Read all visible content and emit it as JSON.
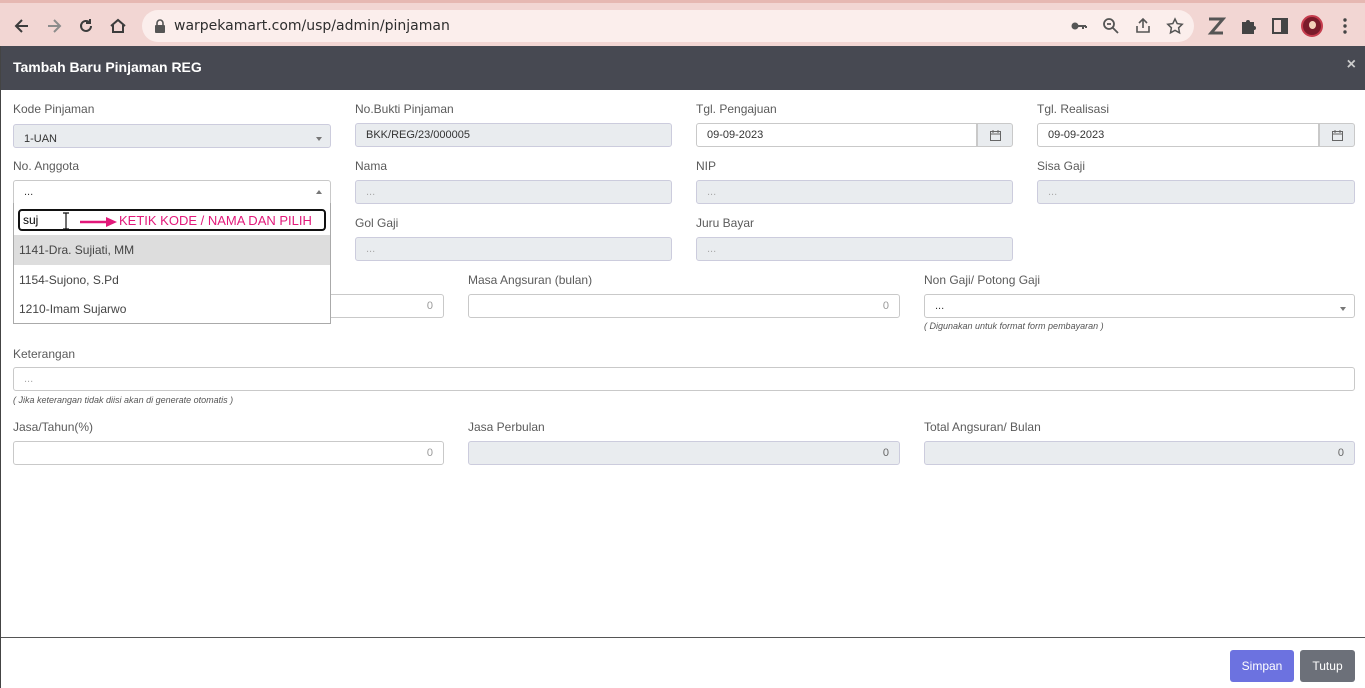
{
  "browser": {
    "url": "warpekamart.com/usp/admin/pinjaman"
  },
  "modal": {
    "title": "Tambah Baru Pinjaman REG",
    "close": "×"
  },
  "form": {
    "kode_pinjaman": {
      "label": "Kode Pinjaman",
      "value": "1-UAN"
    },
    "no_bukti": {
      "label": "No.Bukti Pinjaman",
      "value": "BKK/REG/23/000005"
    },
    "tgl_pengajuan": {
      "label": "Tgl. Pengajuan",
      "value": "09-09-2023"
    },
    "tgl_realisasi": {
      "label": "Tgl. Realisasi",
      "value": "09-09-2023"
    },
    "no_anggota": {
      "label": "No. Anggota",
      "value": "..."
    },
    "nama": {
      "label": "Nama",
      "placeholder": "..."
    },
    "nip": {
      "label": "NIP",
      "placeholder": "..."
    },
    "sisa_gaji": {
      "label": "Sisa Gaji",
      "placeholder": "..."
    },
    "gol_gaji": {
      "label": "Gol Gaji",
      "placeholder": "..."
    },
    "juru_bayar": {
      "label": "Juru Bayar",
      "placeholder": "..."
    },
    "jumlah_hidden": {
      "value": "0"
    },
    "masa_angsuran": {
      "label": "Masa Angsuran (bulan)",
      "value": "0"
    },
    "non_gaji": {
      "label": "Non Gaji/ Potong Gaji",
      "value": "...",
      "hint": "( Digunakan untuk format form pembayaran )"
    },
    "keterangan": {
      "label": "Keterangan",
      "placeholder": "...",
      "hint": "( Jika keterangan tidak diisi akan di generate otomatis )"
    },
    "jasa_tahun": {
      "label": "Jasa/Tahun(%)",
      "value": "0"
    },
    "jasa_perbulan": {
      "label": "Jasa Perbulan",
      "value": "0"
    },
    "total_angsuran": {
      "label": "Total Angsuran/ Bulan",
      "value": "0"
    }
  },
  "dropdown": {
    "search_value": "suj",
    "annotation": "KETIK KODE / NAMA DAN PILIH",
    "annotation_color": "#e2197a",
    "items": [
      "1141-Dra. Sujiati, MM",
      "1154-Sujono, S.Pd",
      "1210-Imam Sujarwo"
    ]
  },
  "footer": {
    "save_label": "Simpan",
    "close_label": "Tutup"
  },
  "icons": [
    "back-icon",
    "forward-icon",
    "reload-icon",
    "home-icon",
    "lock-icon",
    "key-icon",
    "zoom-icon",
    "share-icon",
    "star-icon",
    "z-extension-icon",
    "puzzle-icon",
    "sidepanel-icon",
    "profile-avatar",
    "menu-icon",
    "calendar-icon",
    "arrow-icon",
    "text-cursor-icon"
  ]
}
